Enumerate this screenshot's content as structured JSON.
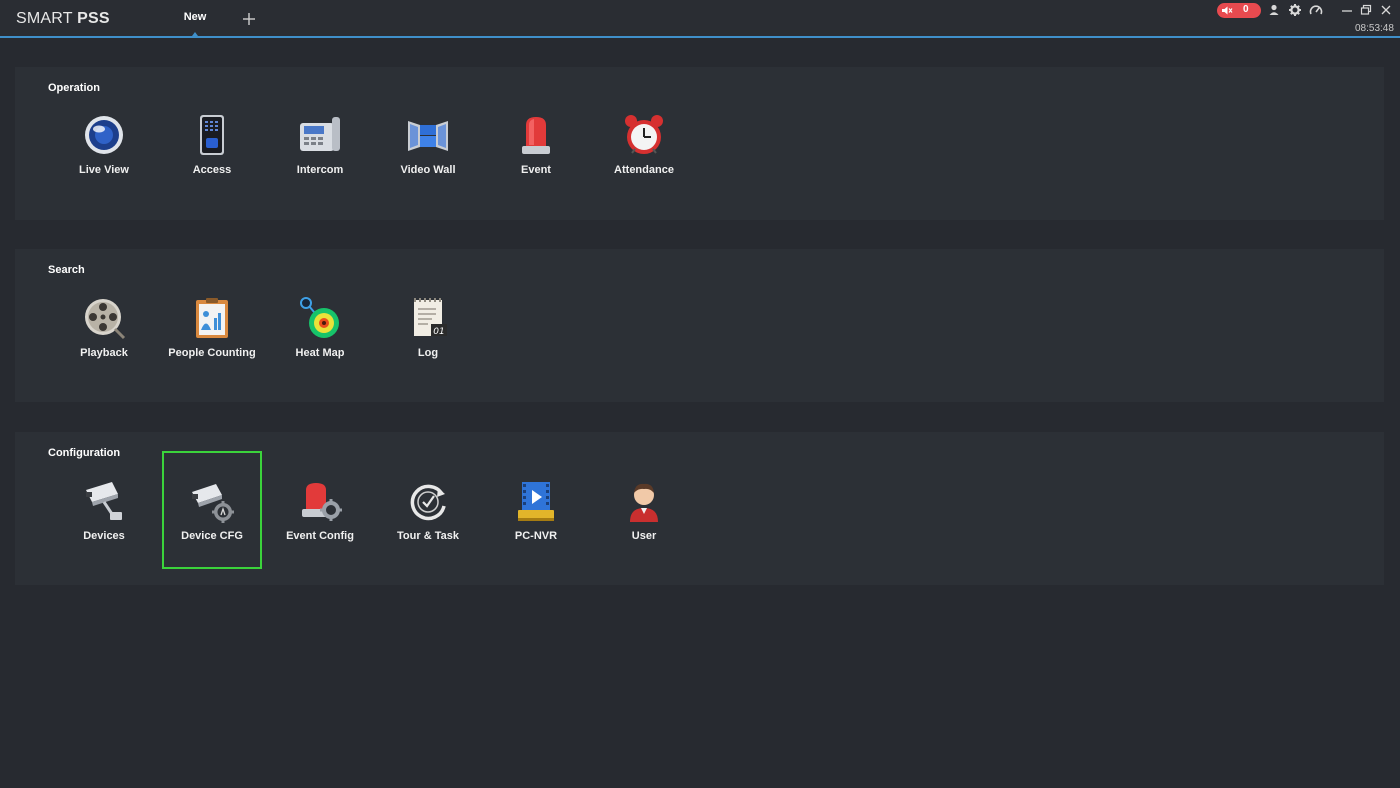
{
  "app": {
    "title_thin": "SMART ",
    "title_bold": "PSS"
  },
  "tabs": [
    {
      "label": "New",
      "active": true
    }
  ],
  "add_tab": "+",
  "status": {
    "alarm_count": "0",
    "time": "08:53:48"
  },
  "colors": {
    "accent": "#3f8fc9",
    "alarm": "#e84a4f",
    "selection": "#3bd33b"
  },
  "sections": [
    {
      "title": "Operation",
      "items": [
        {
          "label": "Live View",
          "icon": "live-view-icon"
        },
        {
          "label": "Access",
          "icon": "access-icon"
        },
        {
          "label": "Intercom",
          "icon": "intercom-icon"
        },
        {
          "label": "Video Wall",
          "icon": "video-wall-icon"
        },
        {
          "label": "Event",
          "icon": "event-icon"
        },
        {
          "label": "Attendance",
          "icon": "attendance-icon"
        }
      ]
    },
    {
      "title": "Search",
      "items": [
        {
          "label": "Playback",
          "icon": "playback-icon"
        },
        {
          "label": "People Counting",
          "icon": "people-counting-icon"
        },
        {
          "label": "Heat Map",
          "icon": "heat-map-icon"
        },
        {
          "label": "Log",
          "icon": "log-icon",
          "badge": "01"
        }
      ]
    },
    {
      "title": "Configuration",
      "items": [
        {
          "label": "Devices",
          "icon": "devices-icon"
        },
        {
          "label": "Device CFG",
          "icon": "device-cfg-icon",
          "selected": true
        },
        {
          "label": "Event Config",
          "icon": "event-config-icon"
        },
        {
          "label": "Tour & Task",
          "icon": "tour-task-icon"
        },
        {
          "label": "PC-NVR",
          "icon": "pc-nvr-icon"
        },
        {
          "label": "User",
          "icon": "user-icon"
        }
      ]
    }
  ]
}
